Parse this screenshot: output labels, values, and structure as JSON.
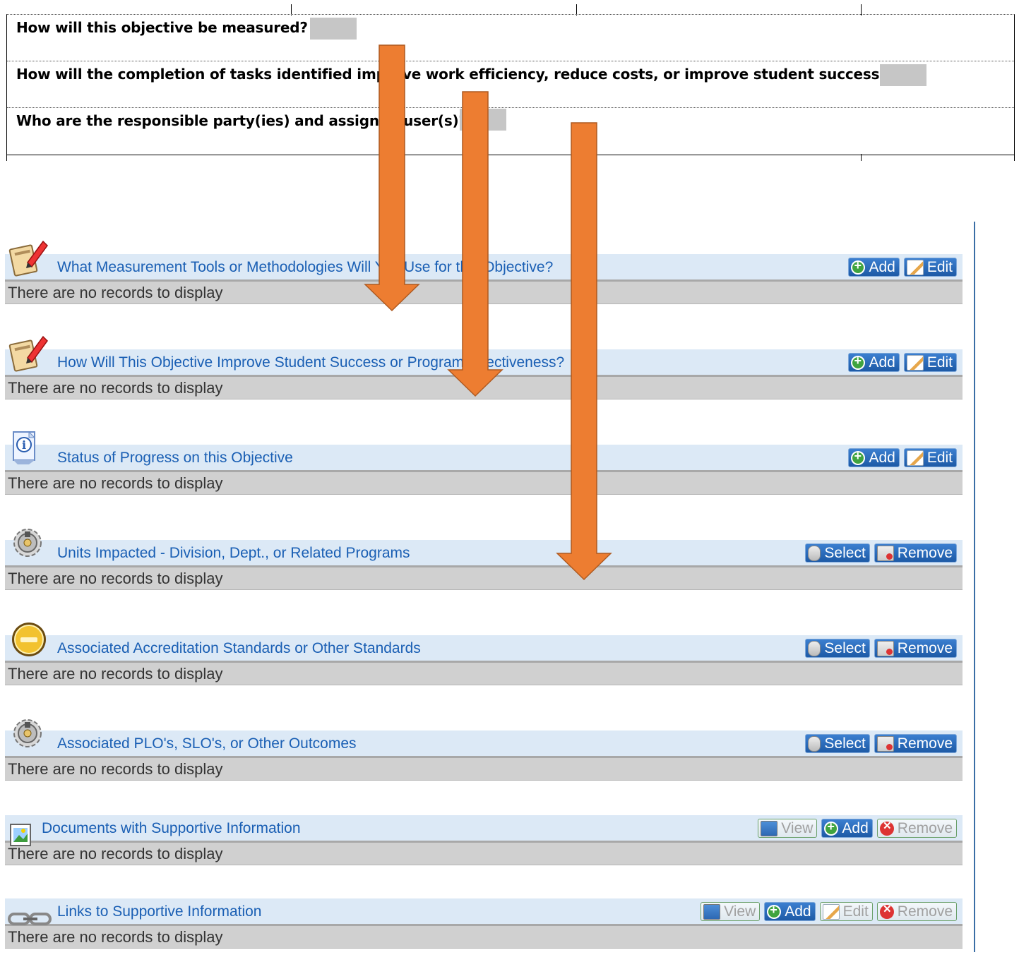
{
  "document": {
    "questions": [
      "How will this objective be measured?",
      "How will the completion of tasks identified improve work efficiency, reduce costs, or improve student success?",
      "Who are the responsible party(ies) and assigned user(s)?"
    ]
  },
  "sections": [
    {
      "title": "What Measurement Tools or Methodologies Will You Use for this Objective?",
      "icon": "edit-document-icon",
      "buttons": [
        "Add",
        "Edit"
      ],
      "empty_text": "There are no records to display"
    },
    {
      "title": "How Will This Objective Improve Student Success or Program Effectiveness?",
      "icon": "edit-document-icon",
      "buttons": [
        "Add",
        "Edit"
      ],
      "empty_text": "There are no records to display"
    },
    {
      "title": "Status of Progress on this Objective",
      "icon": "info-icon",
      "buttons": [
        "Add",
        "Edit"
      ],
      "empty_text": "There are no records to display"
    },
    {
      "title": "Units Impacted - Division, Dept., or Related Programs",
      "icon": "gear-icon",
      "buttons": [
        "Select",
        "Remove"
      ],
      "empty_text": "There are no records to display"
    },
    {
      "title": "Associated Accreditation Standards or Other Standards",
      "icon": "medal-icon",
      "buttons": [
        "Select",
        "Remove"
      ],
      "empty_text": "There are no records to display"
    },
    {
      "title": "Associated PLO's, SLO's, or Other Outcomes",
      "icon": "gear-icon",
      "buttons": [
        "Select",
        "Remove"
      ],
      "empty_text": "There are no records to display"
    },
    {
      "title": "Documents with Supportive Information",
      "icon": "image-document-icon",
      "buttons": [
        "View",
        "Add",
        "Remove"
      ],
      "empty_text": "There are no records to display"
    },
    {
      "title": "Links to Supportive Information",
      "icon": "chain-link-icon",
      "buttons": [
        "View",
        "Add",
        "Edit",
        "Remove"
      ],
      "empty_text": "There are no records to display"
    }
  ],
  "colors": {
    "arrow": "#ed7d31",
    "title": "#1a5fb4",
    "header_bg": "#dce9f6",
    "record_bg": "#d0d0d0"
  }
}
